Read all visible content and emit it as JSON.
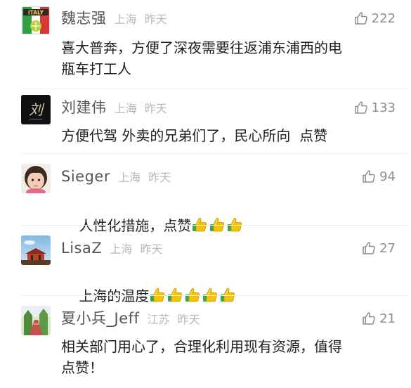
{
  "comments": [
    {
      "name": "魏志强",
      "location": "上海",
      "time": "昨天",
      "likes": "222",
      "text": "喜大普奔，方便了深夜需要往返浦东浦西的电\n瓶车打工人",
      "emoji_count": 0,
      "avatar": "italy-flag-logo",
      "avatar_text": "ITALY"
    },
    {
      "name": "刘建伟",
      "location": "上海",
      "time": "昨天",
      "likes": "133",
      "text": "方便代驾 外卖的兄弟们了，民心所向  点赞",
      "emoji_count": 0,
      "avatar": "calligraphy-logo",
      "avatar_text": "刘"
    },
    {
      "name": "Sieger",
      "location": "上海",
      "time": "昨天",
      "likes": "94",
      "text": "人性化措施，点赞",
      "emoji_count": 3,
      "avatar": "child-photo"
    },
    {
      "name": "LisaZ",
      "location": "上海",
      "time": "昨天",
      "likes": "27",
      "text": "上海的温度",
      "emoji_count": 5,
      "avatar": "temple-sky-photo"
    },
    {
      "name": "夏小兵_Jeff",
      "location": "江苏",
      "time": "昨天",
      "likes": "21",
      "text": "相关部门用心了，合理化利用现有资源，值得\n点赞！",
      "emoji_count": 0,
      "avatar": "park-road-photo"
    }
  ],
  "icons": {
    "like": "thumbs-up-outline-icon",
    "emoji": "thumbs-up-emoji"
  },
  "colors": {
    "name": "#555555",
    "meta": "#b7b7b7",
    "like": "#8e8e8e",
    "emoji_yellow": "#f5c400",
    "emoji_green": "#34a853"
  }
}
